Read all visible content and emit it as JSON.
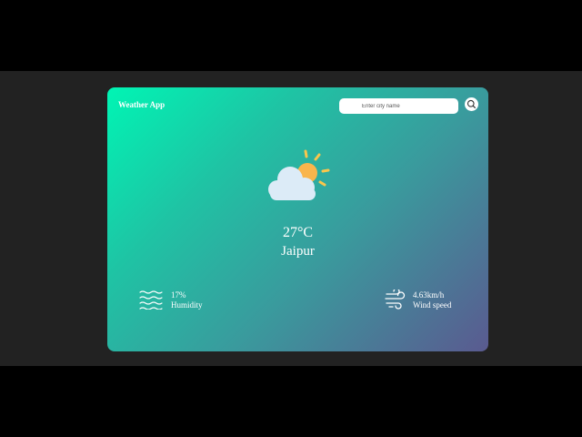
{
  "app": {
    "title": "Weather App"
  },
  "search": {
    "placeholder": "Enter city name",
    "value": "",
    "icon": "search-icon"
  },
  "weather": {
    "icon": "partly-cloudy-icon",
    "temperature": "27°C",
    "city": "Jaipur"
  },
  "details": {
    "humidity": {
      "icon": "humidity-waves-icon",
      "value": "17%",
      "label": "Humidity"
    },
    "wind": {
      "icon": "wind-icon",
      "value": "4.63km/h",
      "label": "Wind speed"
    }
  },
  "colors": {
    "gradient_start": "#00f5b4",
    "gradient_end": "#5a5a90",
    "sun": "#f9b54c",
    "cloud": "#dcebf7",
    "text": "#ffffff",
    "backdrop": "#222222"
  }
}
